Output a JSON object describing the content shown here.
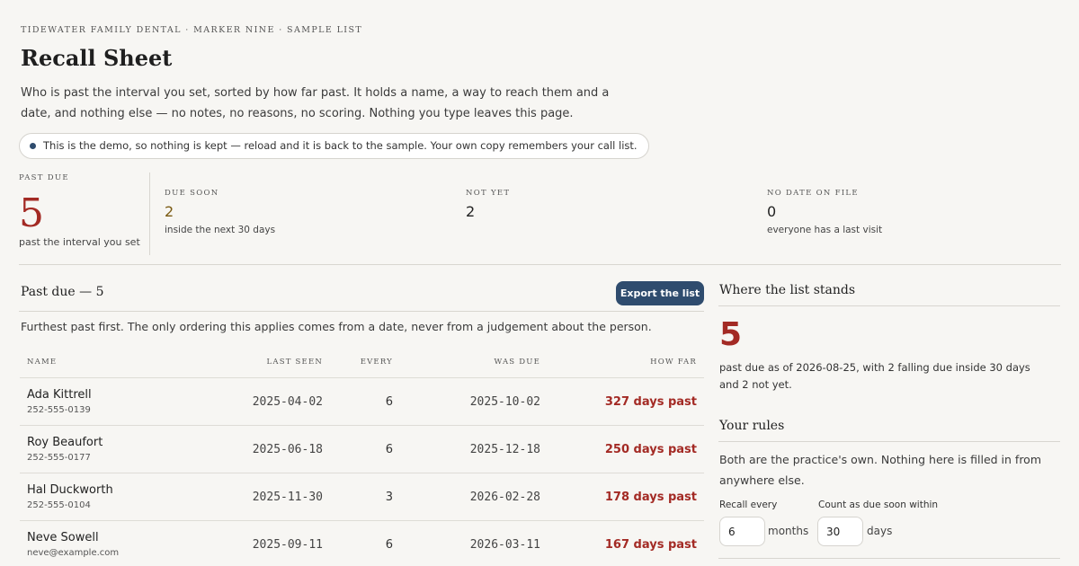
{
  "header": {
    "eyebrow": "TIDEWATER FAMILY DENTAL · MARKER NINE · SAMPLE LIST",
    "title": "Recall Sheet",
    "intro": "Who is past the interval you set, sorted by how far past. It holds a name, a way to reach them and a date, and nothing else — no notes, no reasons, no scoring. Nothing you type leaves this page.",
    "demo_notice": "This is the demo, so nothing is kept — reload and it is back to the sample. Your own copy remembers your call list."
  },
  "stats": {
    "past_due": {
      "label": "PAST DUE",
      "value": "5",
      "sub": "past the interval you set"
    },
    "due_soon": {
      "label": "DUE SOON",
      "value": "2",
      "sub": "inside the next 30 days"
    },
    "not_yet": {
      "label": "NOT YET",
      "value": "2",
      "sub": ""
    },
    "no_date": {
      "label": "NO DATE ON FILE",
      "value": "0",
      "sub": "everyone has a last visit"
    }
  },
  "list": {
    "title": "Past due — 5",
    "export_label": "Export the list",
    "description": "Furthest past first. The only ordering this applies comes from a date, never from a judgement about the person.",
    "columns": [
      "NAME",
      "LAST SEEN",
      "EVERY",
      "WAS DUE",
      "HOW FAR"
    ],
    "rows": [
      {
        "name": "Ada Kittrell",
        "contact": "252-555-0139",
        "last_seen": "2025-04-02",
        "every": "6",
        "was_due": "2025-10-02",
        "how_far": "327 days past"
      },
      {
        "name": "Roy Beaufort",
        "contact": "252-555-0177",
        "last_seen": "2025-06-18",
        "every": "6",
        "was_due": "2025-12-18",
        "how_far": "250 days past"
      },
      {
        "name": "Hal Duckworth",
        "contact": "252-555-0104",
        "last_seen": "2025-11-30",
        "every": "3",
        "was_due": "2026-02-28",
        "how_far": "178 days past"
      },
      {
        "name": "Neve Sowell",
        "contact": "neve@example.com",
        "last_seen": "2025-09-11",
        "every": "6",
        "was_due": "2026-03-11",
        "how_far": "167 days past"
      }
    ]
  },
  "sidebar": {
    "standing_title": "Where the list stands",
    "standing_value": "5",
    "standing_text": "past due as of 2026-08-25, with 2 falling due inside 30 days and 2 not yet.",
    "rules_title": "Your rules",
    "rules_desc": "Both are the practice's own. Nothing here is filled in from anywhere else.",
    "recall_label": "Recall every",
    "recall_value": "6",
    "recall_unit": "months",
    "soon_label": "Count as due soon within",
    "soon_value": "30",
    "soon_unit": "days"
  },
  "colors": {
    "accent": "#2f4c6e",
    "past_due_red": "#a32a24",
    "due_soon_amber": "#7a5a12",
    "background": "#f7f6f3"
  }
}
